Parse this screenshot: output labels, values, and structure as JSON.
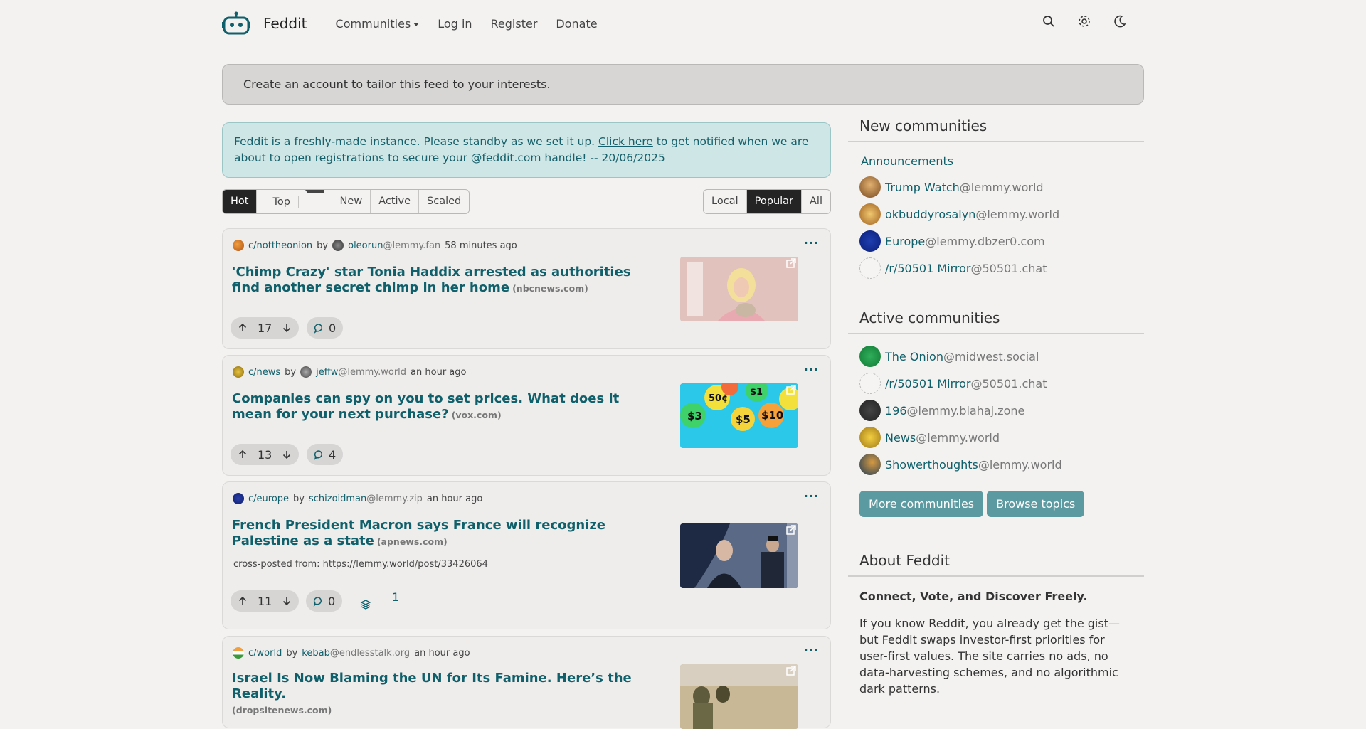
{
  "nav": {
    "brand": "Feddit",
    "links": [
      "Communities",
      "Log in",
      "Register",
      "Donate"
    ],
    "icons": [
      "search-icon",
      "settings-icon",
      "dark-mode-icon"
    ]
  },
  "banner": {
    "text": "Create an account to tailor this feed to your interests."
  },
  "notice": {
    "before": "Feddit is a freshly-made instance. Please standby as we set it up.",
    "link": "Click here",
    "after": "to get notified when we are about to open registrations to secure your @feddit.com handle! -- 20/06/2025"
  },
  "sort": {
    "options": [
      "Hot",
      "Top",
      "New",
      "Active",
      "Scaled"
    ],
    "selected": "Hot"
  },
  "view": {
    "options": [
      "Local",
      "Popular",
      "All"
    ],
    "selected": "Popular"
  },
  "posts": [
    {
      "community": "c/nottheonion",
      "by": "by",
      "user": "oleorun",
      "instance": "@lemmy.fan",
      "time": "58 minutes ago",
      "title": "'Chimp Crazy' star Tonia Haddix arrested as authorities find another secret chimp in her home",
      "domain": "(nbcnews.com)",
      "score": "17",
      "comments": "0"
    },
    {
      "community": "c/news",
      "by": "by",
      "user": "jeffw",
      "instance": "@lemmy.world",
      "time": "an hour ago",
      "title": "Companies can spy on you to set prices. What does it mean for your next purchase?",
      "domain": "(vox.com)",
      "score": "13",
      "comments": "4"
    },
    {
      "community": "c/europe",
      "by": "by",
      "user": "schizoidman",
      "instance": "@lemmy.zip",
      "time": "an hour ago",
      "title": "French President Macron says France will recognize Palestine as a state",
      "domain": "(apnews.com)",
      "crosspost": "cross-posted from: https://lemmy.world/post/33426064",
      "score": "11",
      "comments": "0",
      "crosspost_count": "1"
    },
    {
      "community": "c/world",
      "by": "by",
      "user": "kebab",
      "instance": "@endlesstalk.org",
      "time": "an hour ago",
      "title": "Israel Is Now Blaming the UN for Its Famine. Here’s the Reality.",
      "domain": "(dropsitenews.com)"
    }
  ],
  "sidebar": {
    "new_heading": "New communities",
    "announcements": "Announcements",
    "new_communities": [
      {
        "name": "Trump Watch",
        "instance": "@lemmy.world"
      },
      {
        "name": "okbuddyrosalyn",
        "instance": "@lemmy.world"
      },
      {
        "name": "Europe",
        "instance": "@lemmy.dbzer0.com"
      },
      {
        "name": "/r/50501 Mirror",
        "instance": "@50501.chat"
      }
    ],
    "active_heading": "Active communities",
    "active_communities": [
      {
        "name": "The Onion",
        "instance": "@midwest.social"
      },
      {
        "name": "/r/50501 Mirror",
        "instance": "@50501.chat"
      },
      {
        "name": "196",
        "instance": "@lemmy.blahaj.zone"
      },
      {
        "name": "News",
        "instance": "@lemmy.world"
      },
      {
        "name": "Showerthoughts",
        "instance": "@lemmy.world"
      }
    ],
    "more_button": "More communities",
    "browse_button": "Browse topics",
    "about_heading": "About Feddit",
    "about_tagline": "Connect, Vote, and Discover Freely.",
    "about_body": "If you know Reddit, you already get the gist—but Feddit swaps investor-first priorities for user-first values. The site carries no ads, no data-harvesting schemes, and no algorithmic dark patterns."
  },
  "colors": {
    "accent": "#10606b",
    "button": "#5b9aa0",
    "active_tab": "#242424"
  }
}
